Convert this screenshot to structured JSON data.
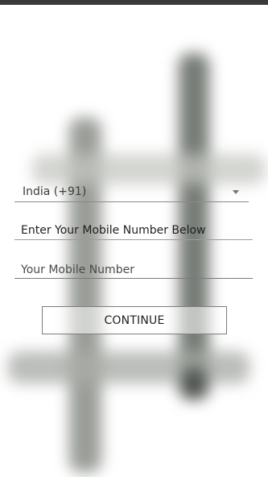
{
  "form": {
    "country_select": {
      "value": "India (+91)"
    },
    "instruction": "Enter Your Mobile Number Below",
    "mobile_input": {
      "placeholder": "Your Mobile Number",
      "value": ""
    },
    "continue_label": "CONTINUE"
  },
  "icons": {
    "dropdown": "chevron-down-icon"
  },
  "colors": {
    "status_bar": "#3a3a3a",
    "background": "#ffffff",
    "text": "#1f1f1f"
  }
}
